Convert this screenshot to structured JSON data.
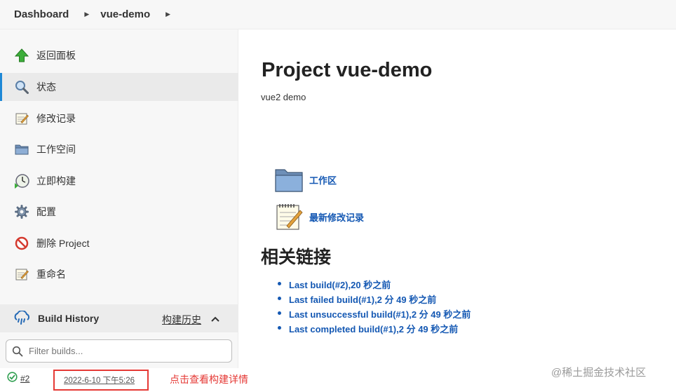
{
  "breadcrumb": {
    "items": [
      "Dashboard",
      "vue-demo"
    ]
  },
  "sidebar": {
    "items": [
      {
        "label": "返回面板",
        "icon": "up-arrow-icon"
      },
      {
        "label": "状态",
        "icon": "magnifier-icon",
        "active": true
      },
      {
        "label": "修改记录",
        "icon": "notepad-icon"
      },
      {
        "label": "工作空间",
        "icon": "folder-icon"
      },
      {
        "label": "立即构建",
        "icon": "clock-build-icon"
      },
      {
        "label": "配置",
        "icon": "gear-icon"
      },
      {
        "label": "删除 Project",
        "icon": "no-entry-icon"
      },
      {
        "label": "重命名",
        "icon": "notepad-icon"
      }
    ]
  },
  "build_history": {
    "title": "Build History",
    "trend_label": "构建历史",
    "filter_placeholder": "Filter builds...",
    "builds": [
      {
        "number": "#2",
        "date": "2022-6-10 下午5:26",
        "status": "success"
      }
    ],
    "annotation": "点击查看构建详情"
  },
  "main": {
    "title": "Project vue-demo",
    "description": "vue2 demo",
    "workspace_link": "工作区",
    "changes_link": "最新修改记录",
    "permalinks_title": "相关链接",
    "permalinks": [
      "Last build(#2),20 秒之前",
      "Last failed build(#1),2 分 49 秒之前",
      "Last unsuccessful build(#1),2 分 49 秒之前",
      "Last completed build(#1),2 分 49 秒之前"
    ]
  },
  "watermark": "@稀土掘金技术社区",
  "colors": {
    "link": "#1458b3",
    "active_indicator": "#1e88d6",
    "highlight": "#e53935",
    "success": "#2e9e4f"
  }
}
